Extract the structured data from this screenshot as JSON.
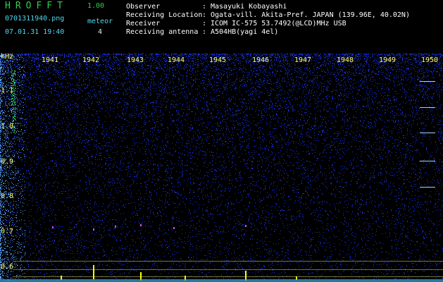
{
  "header": {
    "app_title": "HROFFT",
    "app_version": "1.00",
    "file_name": "0701311940.png",
    "capture_time": "07.01.31 19:40",
    "meteor_label": "meteor",
    "meteor_count": "4"
  },
  "info": [
    {
      "key": "Observer",
      "value": "Masayuki Kobayashi"
    },
    {
      "key": "Receiving Location",
      "value": "Ogata-vill. Akita-Pref. JAPAN (139.96E, 40.02N)"
    },
    {
      "key": "Receiver",
      "value": "ICOM IC-575 53.7492(@LCD)MHz USB"
    },
    {
      "key": "Receiving antenna",
      "value": "A504HB(yagi 4el)"
    }
  ],
  "spectrogram": {
    "unit_label": "kHz",
    "time_labels": [
      "1941",
      "1942",
      "1943",
      "1944",
      "1945",
      "1946",
      "1947",
      "1948",
      "1949",
      "1950"
    ],
    "freq_labels": [
      "1.1",
      "1.0",
      "0.9",
      "0.8",
      "0.7",
      "0.6"
    ],
    "colors": {
      "background": "#000000",
      "noise": "#1f3cff",
      "grid": "#ffff7a",
      "echo": "#ffff00",
      "text_green": "#2fd24a",
      "text_cyan": "#4fd8ee"
    }
  }
}
